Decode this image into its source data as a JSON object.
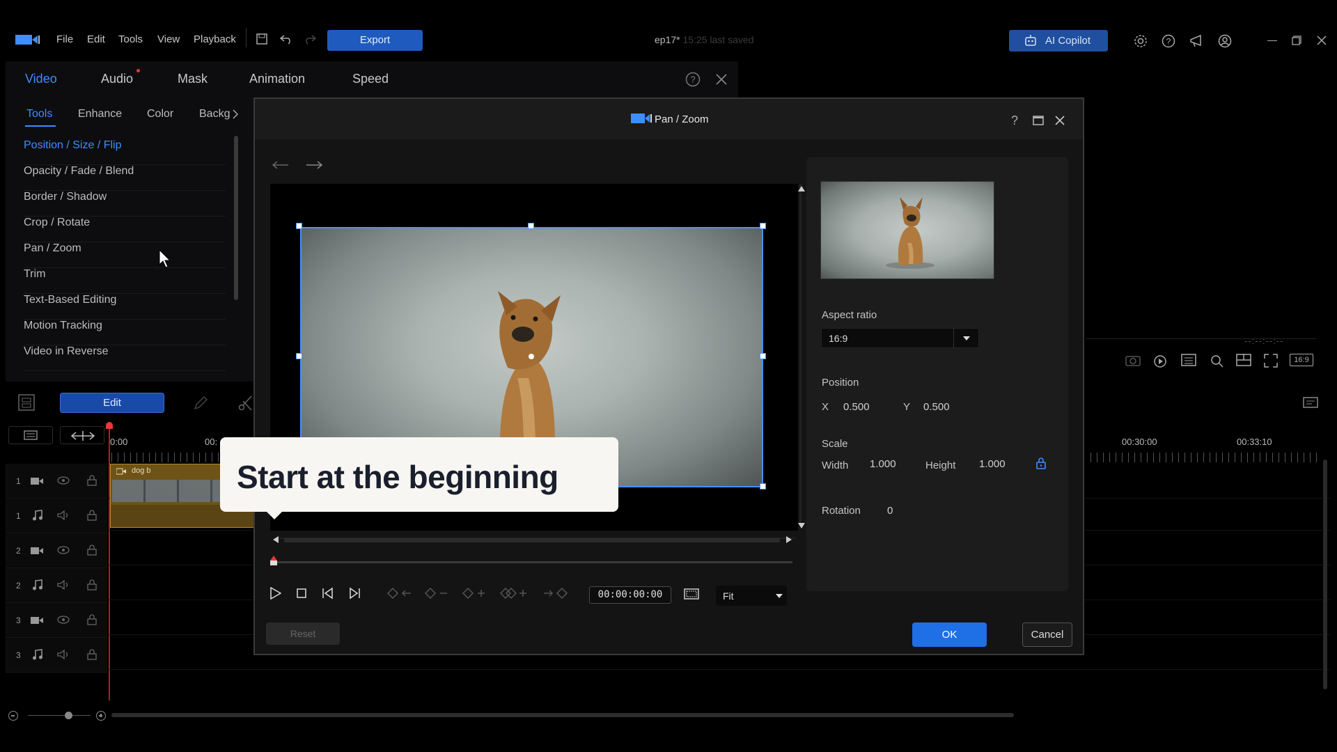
{
  "app": {
    "menu": [
      "File",
      "Edit",
      "Tools",
      "View",
      "Playback"
    ],
    "export_label": "Export",
    "project_name": "ep17*",
    "saved_status": "15:25 last saved",
    "copilot_label": "AI Copilot"
  },
  "left_panel": {
    "tabs": [
      "Video",
      "Audio",
      "Mask",
      "Animation",
      "Speed"
    ],
    "subtabs": [
      "Tools",
      "Enhance",
      "Color",
      "Backg"
    ],
    "tools": [
      "Position / Size / Flip",
      "Opacity / Fade / Blend",
      "Border / Shadow",
      "Crop / Rotate",
      "Pan / Zoom",
      "Trim",
      "Text-Based Editing",
      "Motion Tracking",
      "Video in Reverse"
    ]
  },
  "timeline": {
    "edit_label": "Edit",
    "time_labels": [
      "0:00",
      "00:",
      "00:30:00",
      "00:33:10"
    ],
    "clip_name": "dog b",
    "tracks": [
      "1",
      "1",
      "2",
      "2",
      "3",
      "3"
    ],
    "preview_timecode": "--:--:--:--",
    "aspect_badge": "16:9"
  },
  "dialog": {
    "title": "Pan / Zoom",
    "aspect_ratio_label": "Aspect ratio",
    "aspect_ratio_value": "16:9",
    "position_label": "Position",
    "x_label": "X",
    "x_value": "0.500",
    "y_label": "Y",
    "y_value": "0.500",
    "scale_label": "Scale",
    "width_label": "Width",
    "width_value": "1.000",
    "height_label": "Height",
    "height_value": "1.000",
    "rotation_label": "Rotation",
    "rotation_value": "0",
    "timecode": "00:00:00:00",
    "zoom_value": "Fit",
    "reset_label": "Reset",
    "ok_label": "OK",
    "cancel_label": "Cancel"
  },
  "callout": {
    "text": "Start at the beginning"
  },
  "colors": {
    "accent": "#3d8eff",
    "primary_button": "#1f6fe6",
    "clip": "#6e5318"
  }
}
